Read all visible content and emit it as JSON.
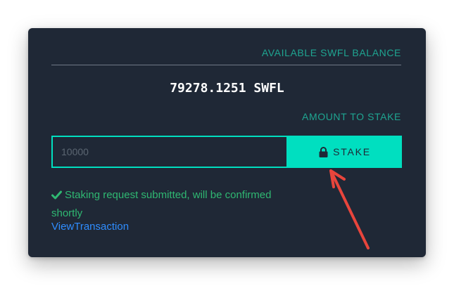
{
  "balance": {
    "label": "AVAILABLE SWFL BALANCE",
    "value": "79278.1251 SWFL"
  },
  "stake": {
    "amount_label": "AMOUNT TO STAKE",
    "input_placeholder": "10000",
    "button_label": "STAKE",
    "button_icon": "lock-icon"
  },
  "status": {
    "icon": "check-icon",
    "message": "Staking request submitted, will be confirmed shortly",
    "link_text": "ViewTransaction"
  },
  "colors": {
    "card_background": "#1f2836",
    "accent": "#00dfc0",
    "label": "#1fa591",
    "success": "#2fb872",
    "link": "#2f8dff",
    "annotation_arrow": "#e8453c"
  }
}
